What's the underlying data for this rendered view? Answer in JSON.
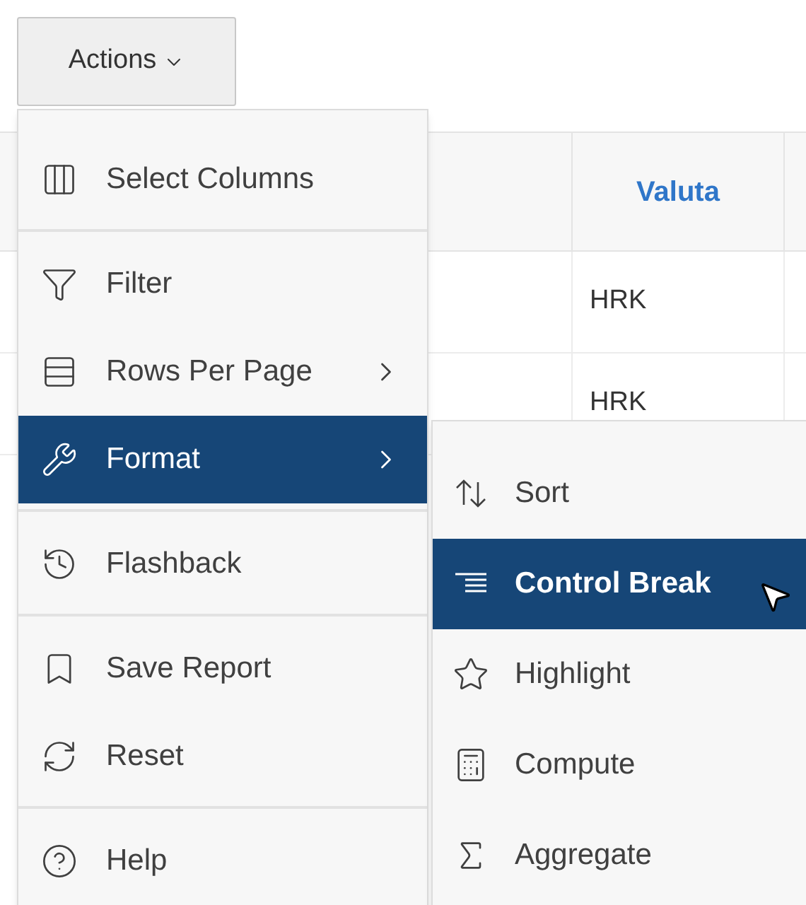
{
  "actions_button": {
    "label": "Actions"
  },
  "table": {
    "columns": [
      "Valuta"
    ],
    "rows": [
      {
        "valuta": "HRK"
      },
      {
        "valuta": "HRK"
      }
    ]
  },
  "menu": {
    "groups": [
      [
        {
          "label": "Select Columns",
          "selected": false,
          "has_submenu": false
        }
      ],
      [
        {
          "label": "Filter",
          "selected": false,
          "has_submenu": false
        },
        {
          "label": "Rows Per Page",
          "selected": false,
          "has_submenu": true
        },
        {
          "label": "Format",
          "selected": true,
          "has_submenu": true
        }
      ],
      [
        {
          "label": "Flashback",
          "selected": false,
          "has_submenu": false
        }
      ],
      [
        {
          "label": "Save Report",
          "selected": false,
          "has_submenu": false
        },
        {
          "label": "Reset",
          "selected": false,
          "has_submenu": false
        }
      ],
      [
        {
          "label": "Help",
          "selected": false,
          "has_submenu": false
        }
      ]
    ]
  },
  "submenu": {
    "items": [
      {
        "label": "Sort",
        "selected": false
      },
      {
        "label": "Control Break",
        "selected": true
      },
      {
        "label": "Highlight",
        "selected": false
      },
      {
        "label": "Compute",
        "selected": false
      },
      {
        "label": "Aggregate",
        "selected": false
      }
    ]
  }
}
